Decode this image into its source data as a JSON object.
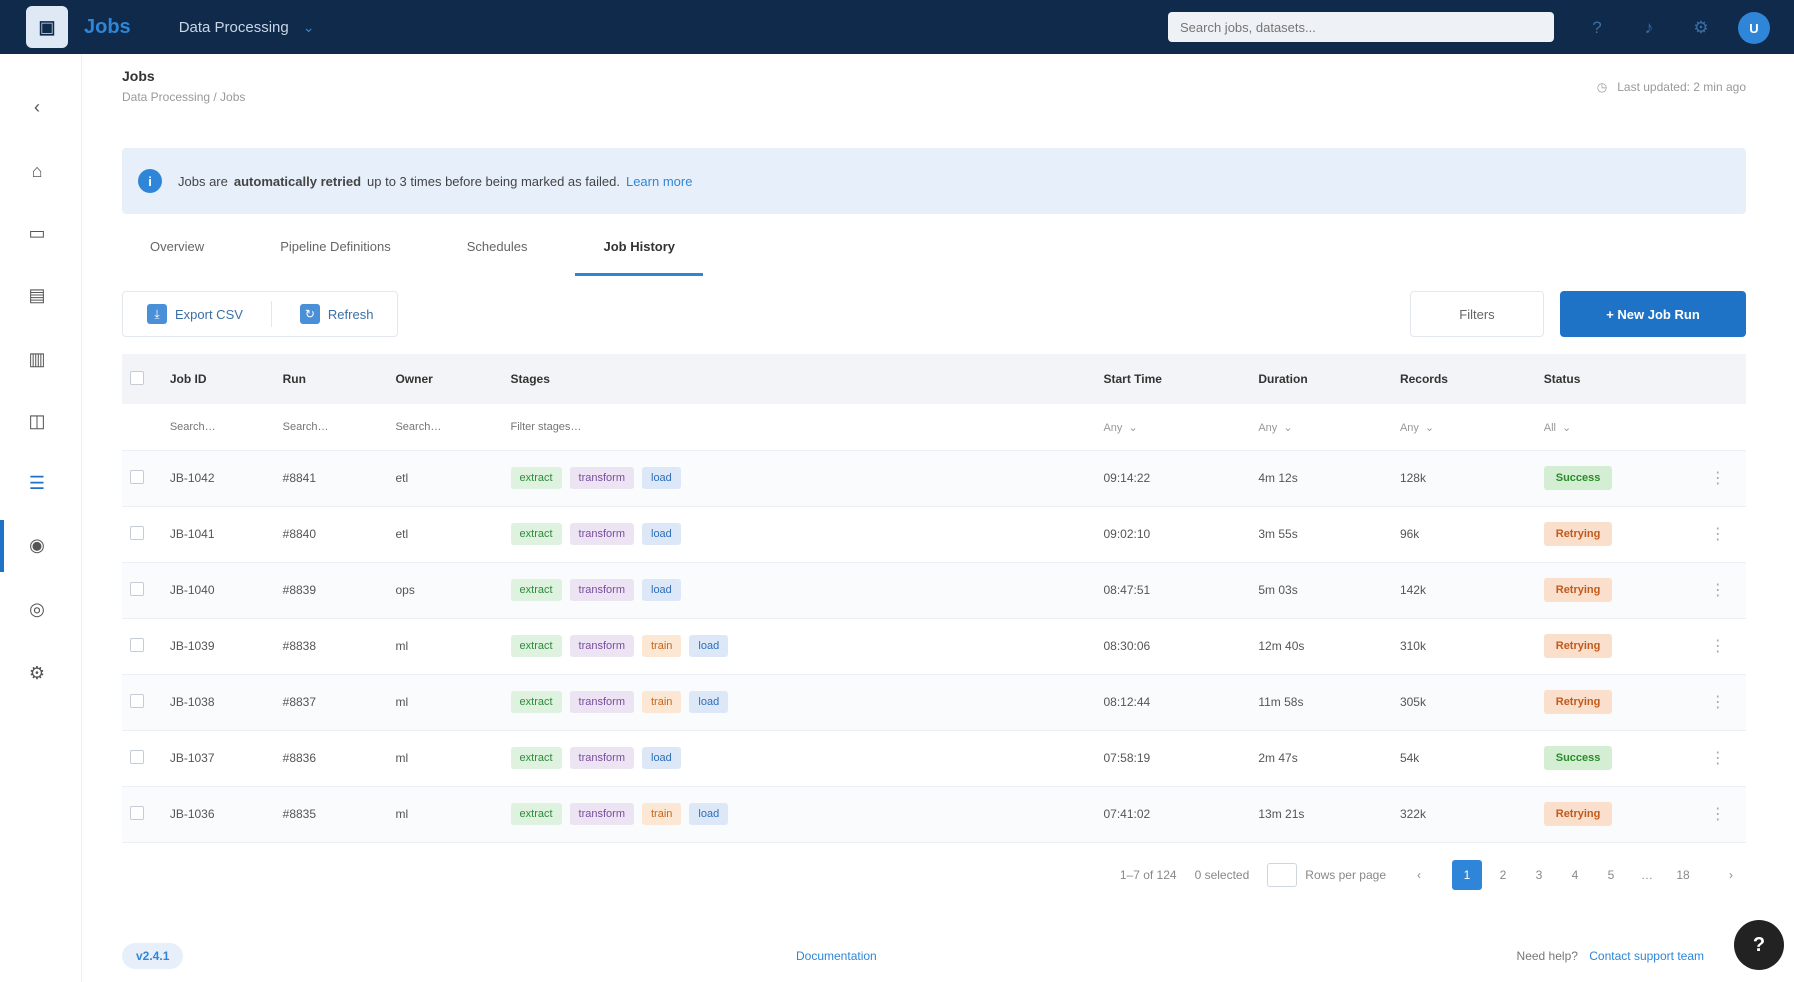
{
  "topbar": {
    "logo_glyph": "▣",
    "brand": "Jobs",
    "project": "Data Processing",
    "project_caret": "⌄",
    "search_placeholder": "Search jobs, datasets...",
    "icons": [
      "help-icon",
      "bell-icon",
      "settings-icon"
    ],
    "avatar_initials": "U"
  },
  "sidebar": {
    "items": [
      {
        "name": "collapse-icon",
        "glyph": "‹"
      },
      {
        "name": "home-icon",
        "glyph": "⌂"
      },
      {
        "name": "folder-icon",
        "glyph": "▭"
      },
      {
        "name": "database-icon",
        "glyph": "▤"
      },
      {
        "name": "chart-icon",
        "glyph": "▥"
      },
      {
        "name": "cube-icon",
        "glyph": "◫"
      },
      {
        "name": "jobs-icon",
        "glyph": "☰"
      },
      {
        "name": "model-icon",
        "glyph": "◉"
      },
      {
        "name": "users-icon",
        "glyph": "◎"
      },
      {
        "name": "settings-icon",
        "glyph": "⚙"
      }
    ],
    "active_index": 6
  },
  "header": {
    "title": "Jobs",
    "subtitle": "Data Processing / Jobs",
    "meta_text": "Last updated: 2 min ago"
  },
  "banner": {
    "icon": "i",
    "text_before": "Jobs are",
    "text_bold": "automatically retried",
    "text_after": "up to 3 times before being marked as failed.",
    "link": "Learn more"
  },
  "tabs": [
    {
      "label": "Overview",
      "active": false
    },
    {
      "label": "Pipeline Definitions",
      "active": false
    },
    {
      "label": "Schedules",
      "active": false
    },
    {
      "label": "Job History",
      "active": true
    }
  ],
  "toolbar": {
    "actions": [
      {
        "label": "Export CSV",
        "glyph": "⤓"
      },
      {
        "label": "Refresh",
        "glyph": "↻"
      }
    ],
    "filter_label": "Filters",
    "primary_label": "+ New Job Run"
  },
  "table": {
    "columns": [
      "",
      "Job ID",
      "Run",
      "Owner",
      "Stages",
      "Start Time",
      "Duration",
      "Records",
      "Status",
      ""
    ],
    "filter_placeholders": [
      "Search…",
      "Search…",
      "Search…",
      "Filter stages…"
    ],
    "filter_selects": [
      "Any",
      "Any",
      "Any",
      "All"
    ],
    "rows": [
      {
        "id": "JB-1042",
        "run": "#8841",
        "owner": "etl",
        "tags": [
          [
            "green",
            "extract"
          ],
          [
            "purple",
            "transform"
          ],
          [
            "blue",
            "load"
          ]
        ],
        "start": "09:14:22",
        "duration": "4m 12s",
        "records": "128k",
        "status": [
          "ok",
          "Success"
        ]
      },
      {
        "id": "JB-1041",
        "run": "#8840",
        "owner": "etl",
        "tags": [
          [
            "green",
            "extract"
          ],
          [
            "purple",
            "transform"
          ],
          [
            "blue",
            "load"
          ]
        ],
        "start": "09:02:10",
        "duration": "3m 55s",
        "records": "96k",
        "status": [
          "warn",
          "Retrying"
        ]
      },
      {
        "id": "JB-1040",
        "run": "#8839",
        "owner": "ops",
        "tags": [
          [
            "green",
            "extract"
          ],
          [
            "purple",
            "transform"
          ],
          [
            "blue",
            "load"
          ]
        ],
        "start": "08:47:51",
        "duration": "5m 03s",
        "records": "142k",
        "status": [
          "warn",
          "Retrying"
        ]
      },
      {
        "id": "JB-1039",
        "run": "#8838",
        "owner": "ml",
        "tags": [
          [
            "green",
            "extract"
          ],
          [
            "purple",
            "transform"
          ],
          [
            "orange",
            "train"
          ],
          [
            "blue",
            "load"
          ]
        ],
        "start": "08:30:06",
        "duration": "12m 40s",
        "records": "310k",
        "status": [
          "warn",
          "Retrying"
        ]
      },
      {
        "id": "JB-1038",
        "run": "#8837",
        "owner": "ml",
        "tags": [
          [
            "green",
            "extract"
          ],
          [
            "purple",
            "transform"
          ],
          [
            "orange",
            "train"
          ],
          [
            "blue",
            "load"
          ]
        ],
        "start": "08:12:44",
        "duration": "11m 58s",
        "records": "305k",
        "status": [
          "warn",
          "Retrying"
        ]
      },
      {
        "id": "JB-1037",
        "run": "#8836",
        "owner": "ml",
        "tags": [
          [
            "green",
            "extract"
          ],
          [
            "purple",
            "transform"
          ],
          [
            "blue",
            "load"
          ]
        ],
        "start": "07:58:19",
        "duration": "2m 47s",
        "records": "54k",
        "status": [
          "ok",
          "Success"
        ]
      },
      {
        "id": "JB-1036",
        "run": "#8835",
        "owner": "ml",
        "tags": [
          [
            "green",
            "extract"
          ],
          [
            "purple",
            "transform"
          ],
          [
            "orange",
            "train"
          ],
          [
            "blue",
            "load"
          ]
        ],
        "start": "07:41:02",
        "duration": "13m 21s",
        "records": "322k",
        "status": [
          "warn",
          "Retrying"
        ]
      }
    ]
  },
  "pagination": {
    "range_text": "1–7 of 124",
    "selected_text": "0 selected",
    "page_size_label": "Rows per page",
    "prev": "‹",
    "next": "›",
    "pages": [
      "1",
      "2",
      "3",
      "4",
      "5",
      "…",
      "18"
    ],
    "active_page": "1"
  },
  "footer": {
    "left_label": "v2.4.1",
    "center_link": "Documentation",
    "right_text": "Need help?",
    "right_link": "Contact support team"
  },
  "help_fab": "?",
  "colors": {
    "topbar": "#0f2a4a",
    "accent": "#1f73c7",
    "banner": "#e7f0fa",
    "success": "#2a8a2a",
    "warning": "#c25a1b"
  }
}
